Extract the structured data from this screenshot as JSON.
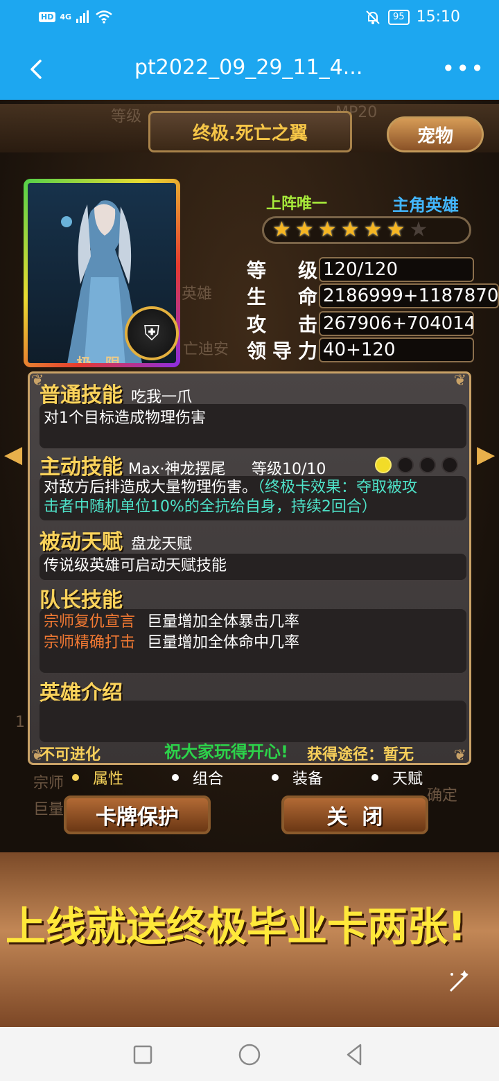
{
  "status_bar": {
    "hd": "HD",
    "signal": "4G",
    "battery": "95",
    "time": "15:10"
  },
  "title_bar": {
    "title": "pt2022_09_29_11_4..."
  },
  "game": {
    "card_title": "终极.死亡之翼",
    "pet_button": "宠物",
    "card_grade": "极 限",
    "unique_tag": "上阵唯一",
    "hero_type": "主角英雄",
    "stars": {
      "filled": 6,
      "total": 7
    },
    "stats": [
      {
        "label": "等级",
        "value": "120/120"
      },
      {
        "label": "生命",
        "value": "2186999+1187870"
      },
      {
        "label": "攻击",
        "value": "267906+704014"
      },
      {
        "label": "领导力",
        "value": "40+120"
      }
    ],
    "normal_skill": {
      "title": "普通技能",
      "name": "吃我一爪",
      "desc": "对1个目标造成物理伤害"
    },
    "active_skill": {
      "title": "主动技能",
      "name": "Max·神龙摆尾",
      "level": "等级10/10",
      "level_dots": {
        "filled": 1,
        "total": 4
      },
      "desc": "对敌方后排造成大量物理伤害。",
      "desc_extra_line1": "（终极卡效果：夺取被攻",
      "desc_extra_line2": "击者中随机单位10%的全抗给自身，持续2回合）"
    },
    "passive": {
      "title": "被动天赋",
      "name": "盘龙天赋",
      "desc": "传说级英雄可启动天赋技能"
    },
    "leader_skill": {
      "title": "队长技能",
      "items": [
        {
          "name": "宗师复仇宣言",
          "desc": "巨量增加全体暴击几率"
        },
        {
          "name": "宗师精确打击",
          "desc": "巨量增加全体命中几率"
        }
      ]
    },
    "intro": {
      "title": "英雄介绍",
      "text": ""
    },
    "footer": {
      "left": "不可进化",
      "mid": "祝大家玩得开心!",
      "right": "获得途径：暂无"
    },
    "tabs": [
      "属性",
      "组合",
      "装备",
      "天赋"
    ],
    "protect_button": "卡牌保护",
    "close_button": "关  闭",
    "bg_ghost": {
      "level": "等级",
      "mp": "MP20",
      "hero": "英雄",
      "name": "亡迪安",
      "confirm": "确定",
      "leader": "宗师",
      "big": "巨量",
      "num": "1"
    }
  },
  "banner": {
    "text": "上线就送终极毕业卡两张!"
  },
  "colors": {
    "status_bar": "#1da7f0",
    "gold_text": "#fbd35b",
    "teal_text": "#4ee3c9",
    "orange_text": "#f47a33",
    "banner_text": "#ffe83a"
  }
}
